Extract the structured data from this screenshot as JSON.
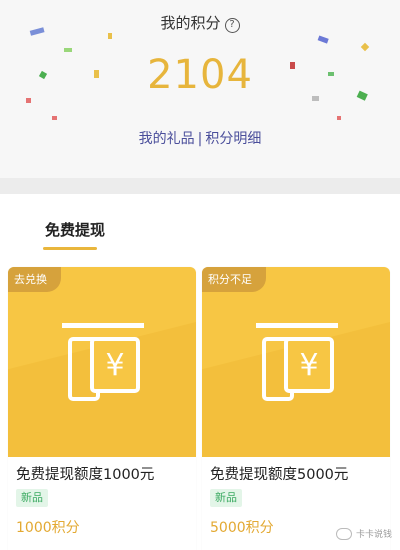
{
  "header": {
    "title": "我的积分",
    "help_icon_glyph": "?",
    "points": "2104",
    "link_gifts": "我的礼品",
    "link_separator": "|",
    "link_details": "积分明细"
  },
  "section": {
    "title": "免费提现"
  },
  "cards": [
    {
      "badge": "去兑换",
      "name": "免费提现额度1000元",
      "tag": "新品",
      "price": "1000积分"
    },
    {
      "badge": "积分不足",
      "name": "免费提现额度5000元",
      "tag": "新品",
      "price": "5000积分"
    }
  ],
  "watermark": {
    "text": "卡卡说钱"
  },
  "icons": {
    "help": "question-circle-icon",
    "atm": "atm-cash-icon",
    "wechat": "wechat-logo-icon"
  },
  "colors": {
    "points": "#e7b53c",
    "link": "#4a4e9b",
    "card_bg": "#f7c644",
    "badge_bg": "#d6a23c",
    "tag_bg": "#e3f5e8",
    "tag_text": "#3dab63",
    "price": "#e3a932"
  }
}
